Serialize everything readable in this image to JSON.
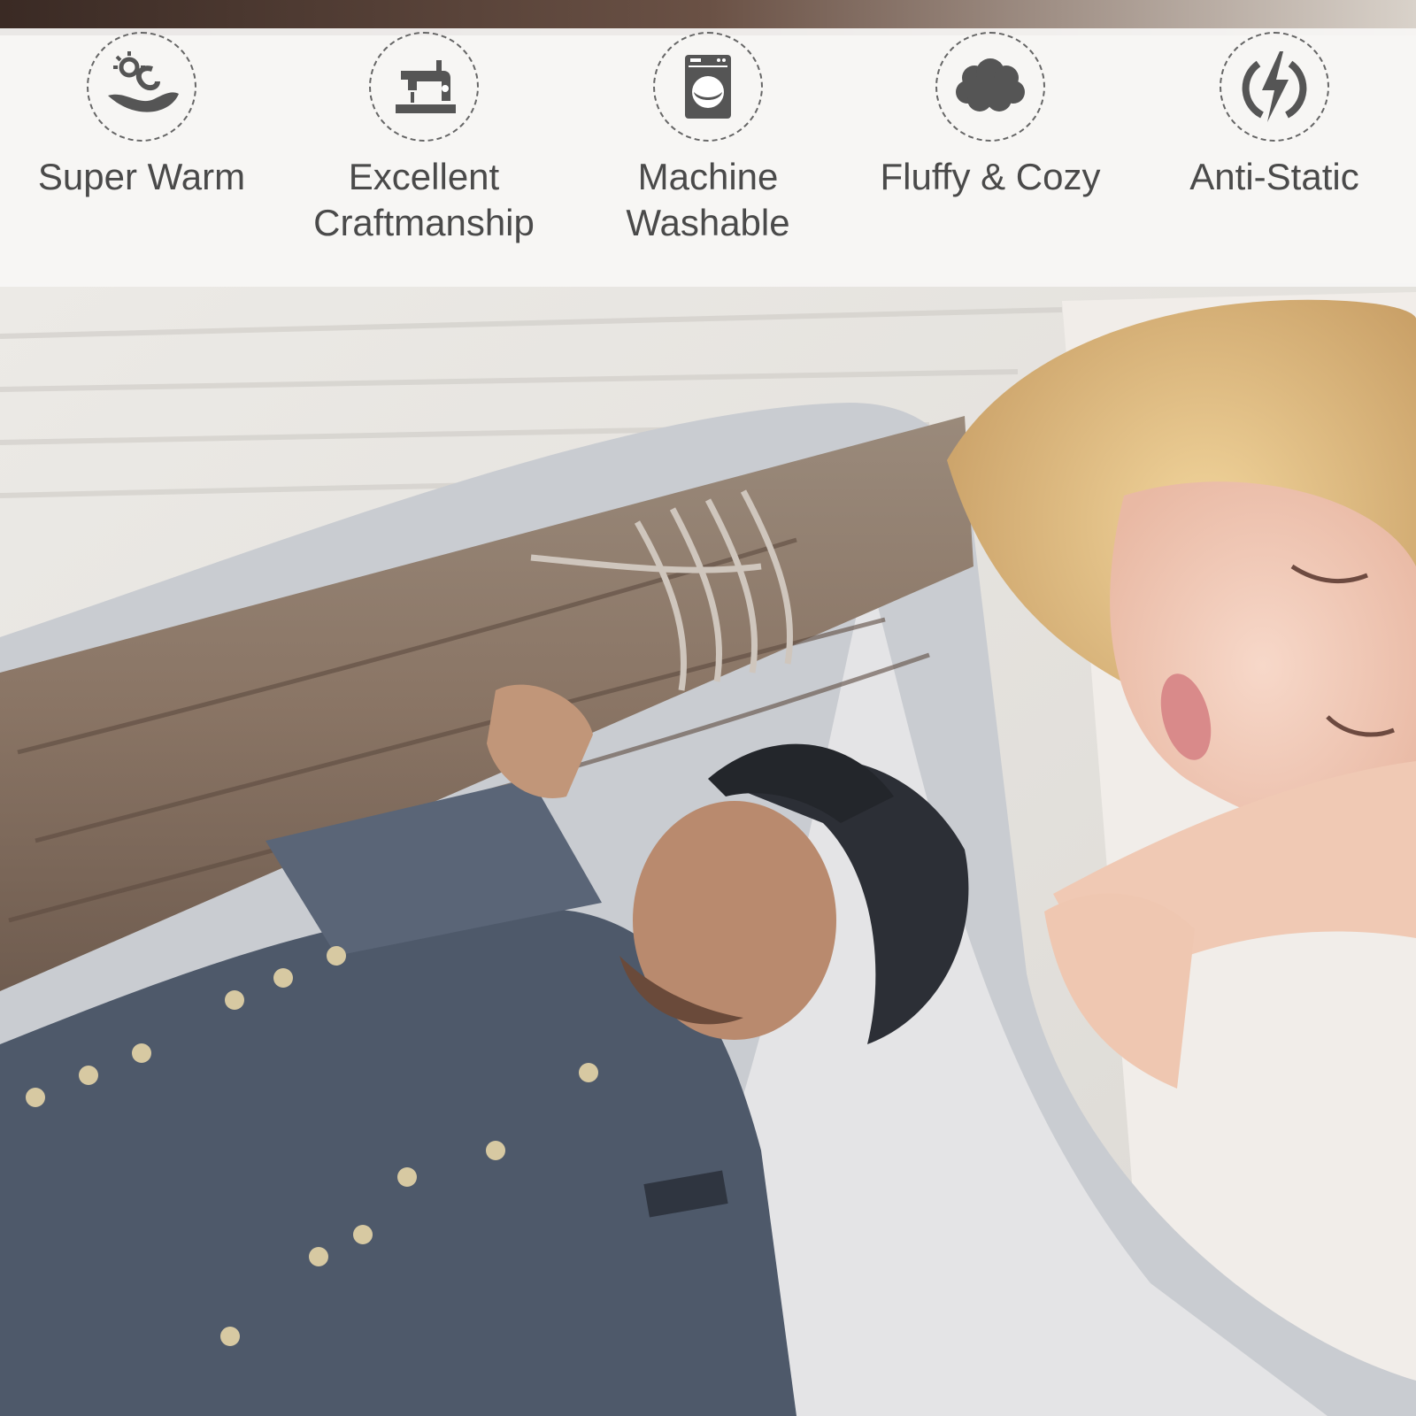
{
  "colors": {
    "icon": "#555555",
    "label": "#4a4a4a",
    "band": "#f7f6f5"
  },
  "features": [
    {
      "icon": "sun-wave-icon",
      "label": "Super Warm"
    },
    {
      "icon": "sewing-machine-icon",
      "label": "Excellent Craftmanship"
    },
    {
      "icon": "washing-machine-icon",
      "label": "Machine Washable"
    },
    {
      "icon": "cloud-icon",
      "label": "Fluffy & Cozy"
    },
    {
      "icon": "lightning-icon",
      "label": "Anti-Static"
    }
  ]
}
